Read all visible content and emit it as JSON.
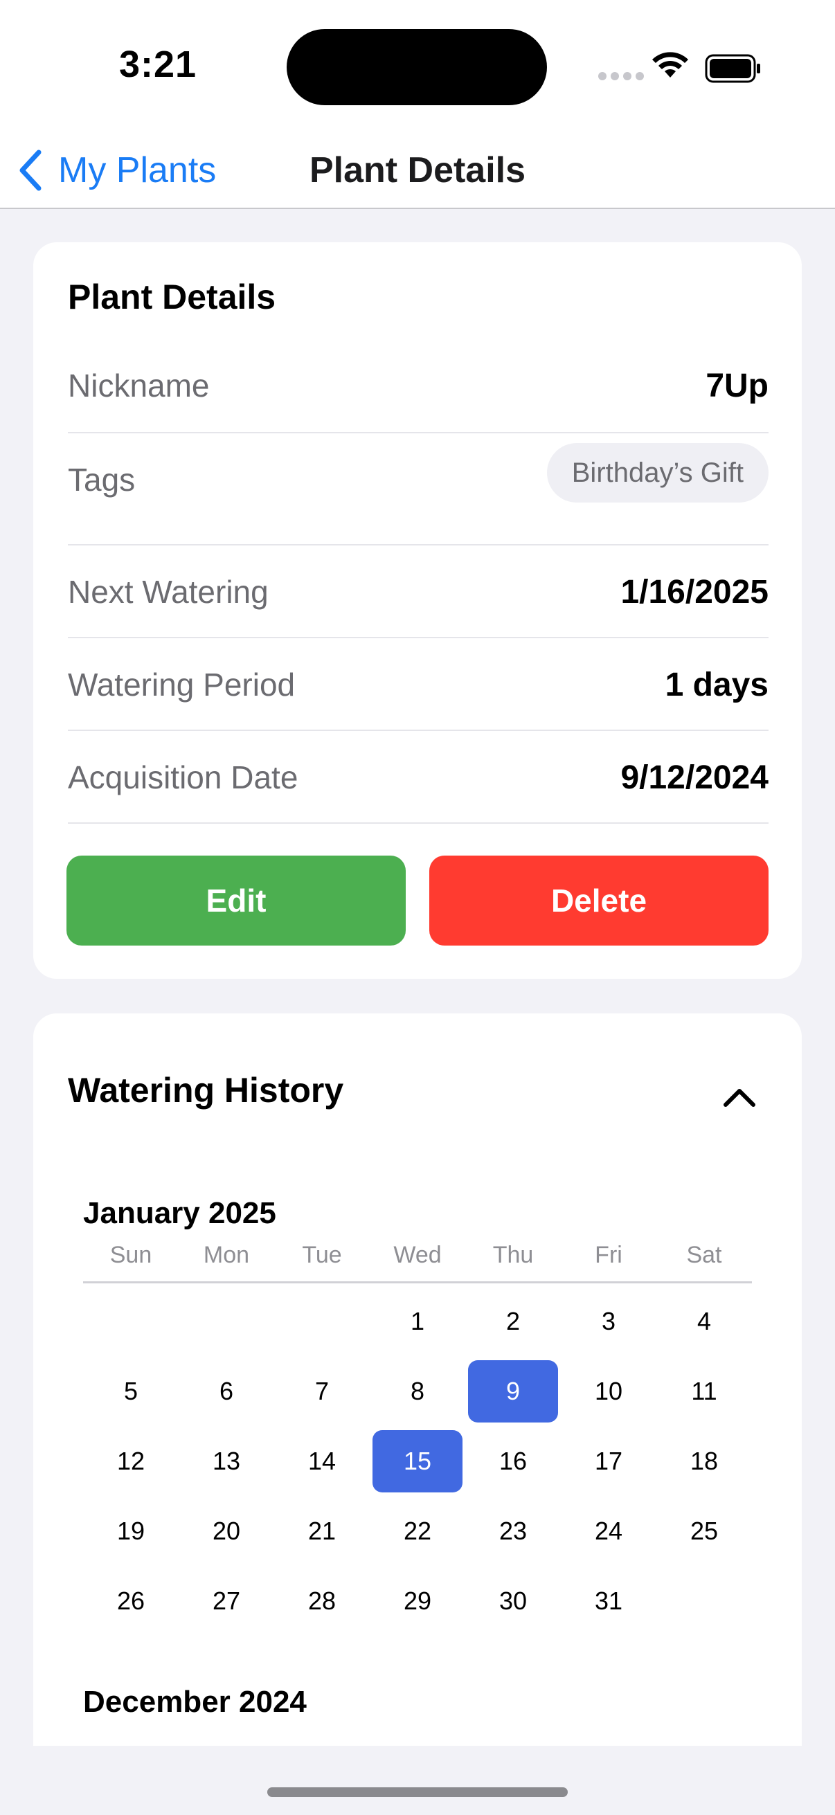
{
  "status_bar": {
    "time": "3:21",
    "icons": [
      "cellular-dots-icon",
      "wifi-icon",
      "battery-icon"
    ]
  },
  "nav": {
    "back_label": "My Plants",
    "title": "Plant Details",
    "back_icon": "chevron-left-icon"
  },
  "details": {
    "title": "Plant Details",
    "rows": [
      {
        "label": "Nickname",
        "value": "7Up"
      },
      {
        "label": "Tags",
        "tag": "Birthday’s Gift"
      },
      {
        "label": "Next Watering",
        "value": "1/16/2025"
      },
      {
        "label": "Watering Period",
        "value": "1 days"
      },
      {
        "label": "Acquisition Date",
        "value": "9/12/2024"
      }
    ],
    "edit_label": "Edit",
    "delete_label": "Delete"
  },
  "history": {
    "title": "Watering History",
    "toggle_icon": "chevron-up-icon",
    "weekdays": [
      "Sun",
      "Mon",
      "Tue",
      "Wed",
      "Thu",
      "Fri",
      "Sat"
    ],
    "months": [
      {
        "title": "January 2025",
        "first_weekday": 3,
        "days_in_month": 31,
        "watered_days": [
          9,
          15
        ]
      },
      {
        "title": "December 2024"
      }
    ]
  },
  "colors": {
    "accent": "#1a7cf5",
    "edit": "#4caf50",
    "delete": "#ff3b30",
    "watered_day": "#4169e1",
    "background": "#f2f2f7"
  }
}
